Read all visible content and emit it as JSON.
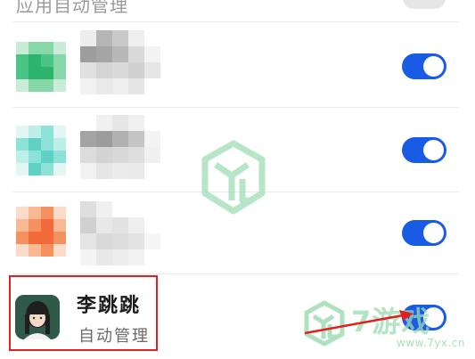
{
  "top_partial": {
    "label": "应用自动管理"
  },
  "rows": [
    {
      "name": "blurred-app-1",
      "toggle_on": true,
      "icon_colors": [
        "#2cb36c",
        "#4bc488",
        "#86d8a8",
        "#c8ecd6"
      ]
    },
    {
      "name": "blurred-app-2",
      "toggle_on": true,
      "icon_colors": [
        "#5fd1c4",
        "#8de2d8",
        "#bdeee8",
        "#e2f7f4"
      ]
    },
    {
      "name": "blurred-app-3",
      "toggle_on": true,
      "icon_colors": [
        "#f26a3a",
        "#f5915f",
        "#f8b894",
        "#fcdcc8"
      ]
    }
  ],
  "highlighted_app": {
    "name": "李跳跳",
    "subtitle": "自动管理",
    "toggle_on": true
  },
  "watermark": {
    "brand": "7游戏",
    "url": "www.7yx.cn"
  },
  "colors": {
    "toggle_on": "#1a5be5",
    "highlight_border": "#e02020",
    "watermark": "#9adbb0",
    "avatar_bg": "#2f5a4a"
  }
}
